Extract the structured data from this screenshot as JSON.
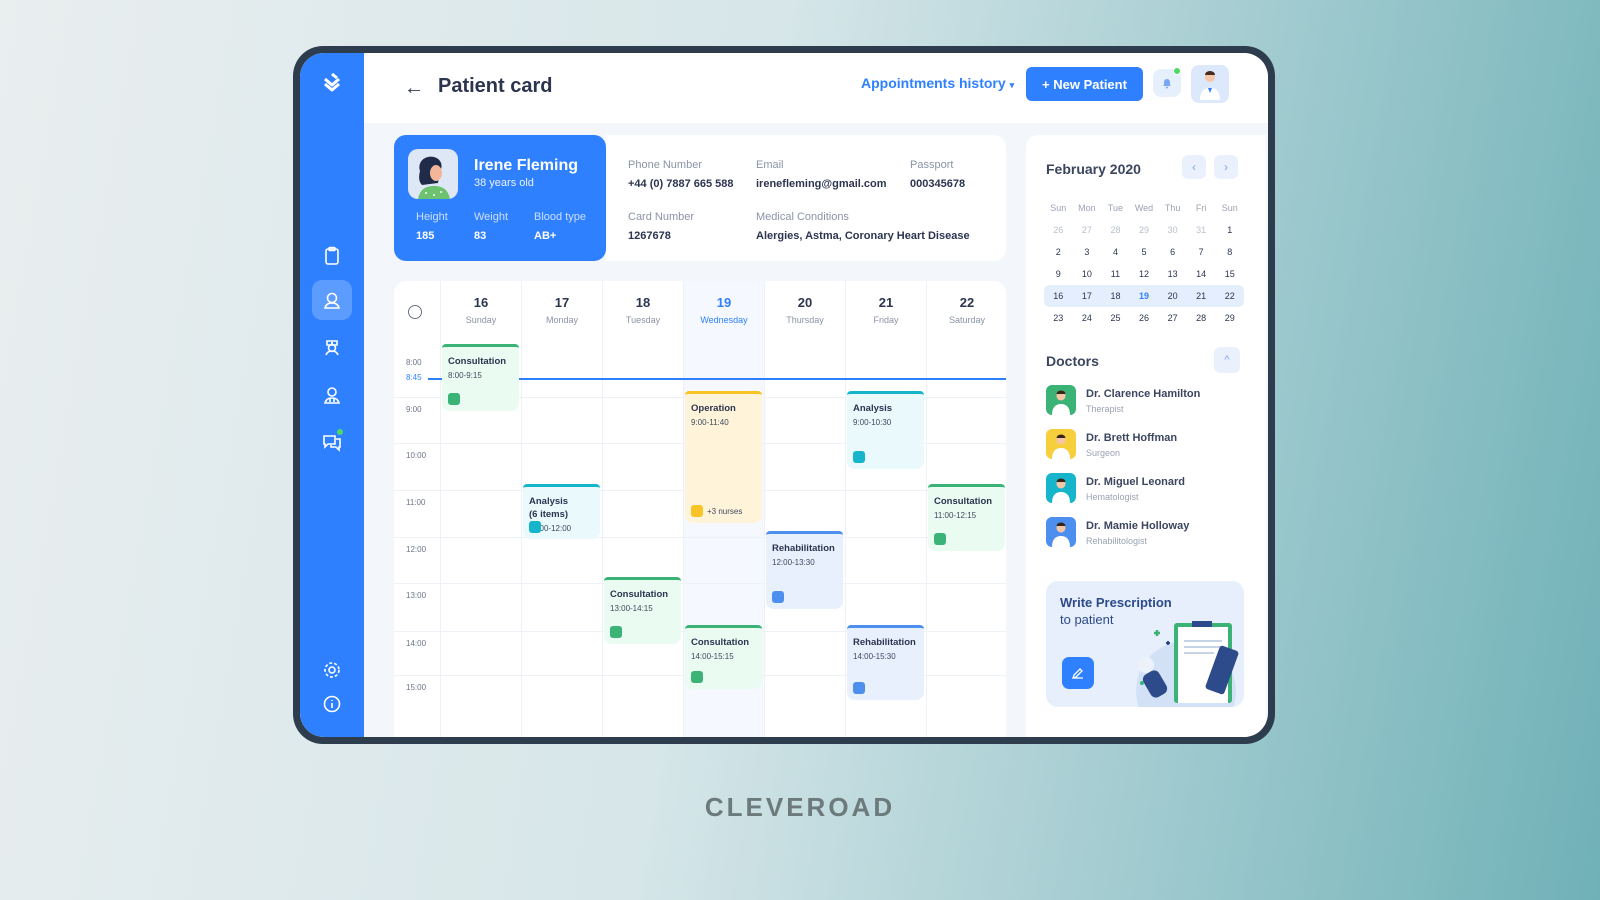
{
  "header": {
    "title": "Patient card",
    "back_icon": "←",
    "appointments_label": "Appointments history",
    "appointments_caret": "▾",
    "new_patient_label": "+ New Patient",
    "bell_icon": "🔔"
  },
  "sidebar": {
    "logo": "≫",
    "items": [
      {
        "name": "clipboard"
      },
      {
        "name": "patient",
        "active": true
      },
      {
        "name": "nurse"
      },
      {
        "name": "doctor"
      },
      {
        "name": "chat",
        "badge": true
      }
    ],
    "bottom": [
      {
        "name": "settings"
      },
      {
        "name": "info"
      }
    ]
  },
  "patient": {
    "name": "Irene Fleming",
    "age": "38 years old",
    "stats": [
      {
        "label": "Height",
        "value": "185"
      },
      {
        "label": "Weight",
        "value": "83"
      },
      {
        "label": "Blood type",
        "value": "AB+"
      }
    ],
    "fields": [
      {
        "label": "Phone Number",
        "value": "+44 (0) 7887 665 588"
      },
      {
        "label": "Email",
        "value": "irenefleming@gmail.com"
      },
      {
        "label": "Passport",
        "value": "000345678"
      },
      {
        "label": "Card Number",
        "value": "1267678"
      },
      {
        "label": "Medical Conditions",
        "value": "Alergies, Astma, Coronary Heart Disease"
      }
    ]
  },
  "schedule": {
    "days": [
      {
        "num": "16",
        "name": "Sunday"
      },
      {
        "num": "17",
        "name": "Monday"
      },
      {
        "num": "18",
        "name": "Tuesday"
      },
      {
        "num": "19",
        "name": "Wednesday",
        "today": true
      },
      {
        "num": "20",
        "name": "Thursday"
      },
      {
        "num": "21",
        "name": "Friday"
      },
      {
        "num": "22",
        "name": "Saturday"
      }
    ],
    "times": [
      "8:00",
      "9:00",
      "10:00",
      "11:00",
      "12:00",
      "13:00",
      "14:00",
      "15:00"
    ],
    "now_label": "8:45",
    "events": [
      {
        "title": "Consultation",
        "time": "8:00-9:15",
        "color": "green"
      },
      {
        "title": "Analysis\n(6 items)",
        "time": "11:00-12:00",
        "color": "teal"
      },
      {
        "title": "Consultation",
        "time": "13:00-14:15",
        "color": "green"
      },
      {
        "title": "Operation",
        "time": "9:00-11:40",
        "color": "yellow",
        "extra": "+3 nurses"
      },
      {
        "title": "Consultation",
        "time": "14:00-15:15",
        "color": "green"
      },
      {
        "title": "Rehabilitation",
        "time": "12:00-13:30",
        "color": "blue"
      },
      {
        "title": "Analysis",
        "time": "9:00-10:30",
        "color": "teal"
      },
      {
        "title": "Rehabilitation",
        "time": "14:00-15:30",
        "color": "blue"
      },
      {
        "title": "Consultation",
        "time": "11:00-12:15",
        "color": "green"
      }
    ]
  },
  "calendar": {
    "title": "February 2020",
    "prev": "‹",
    "next": "›",
    "weekdays": [
      "Sun",
      "Mon",
      "Tue",
      "Wed",
      "Thu",
      "Fri",
      "Sun"
    ],
    "weeks": [
      [
        "26",
        "27",
        "28",
        "29",
        "30",
        "31",
        "1"
      ],
      [
        "2",
        "3",
        "4",
        "5",
        "6",
        "7",
        "8"
      ],
      [
        "9",
        "10",
        "11",
        "12",
        "13",
        "14",
        "15"
      ],
      [
        "16",
        "17",
        "18",
        "19",
        "20",
        "21",
        "22"
      ],
      [
        "23",
        "24",
        "25",
        "26",
        "27",
        "28",
        "29"
      ]
    ],
    "selected_week": 3,
    "today": "19"
  },
  "doctors": {
    "title": "Doctors",
    "collapse_icon": "^",
    "list": [
      {
        "name": "Dr. Clarence Hamilton",
        "role": "Therapist",
        "color": "#3bb377"
      },
      {
        "name": "Dr. Brett Hoffman",
        "role": "Surgeon",
        "color": "#f7cf3c"
      },
      {
        "name": "Dr. Miguel Leonard",
        "role": "Hematologist",
        "color": "#17b5cc"
      },
      {
        "name": "Dr. Mamie Holloway",
        "role": "Rehabilitologist",
        "color": "#4d8fee"
      }
    ]
  },
  "prescription": {
    "title": "Write Prescription",
    "subtitle": "to patient"
  },
  "brand": "CLEVEROAD"
}
